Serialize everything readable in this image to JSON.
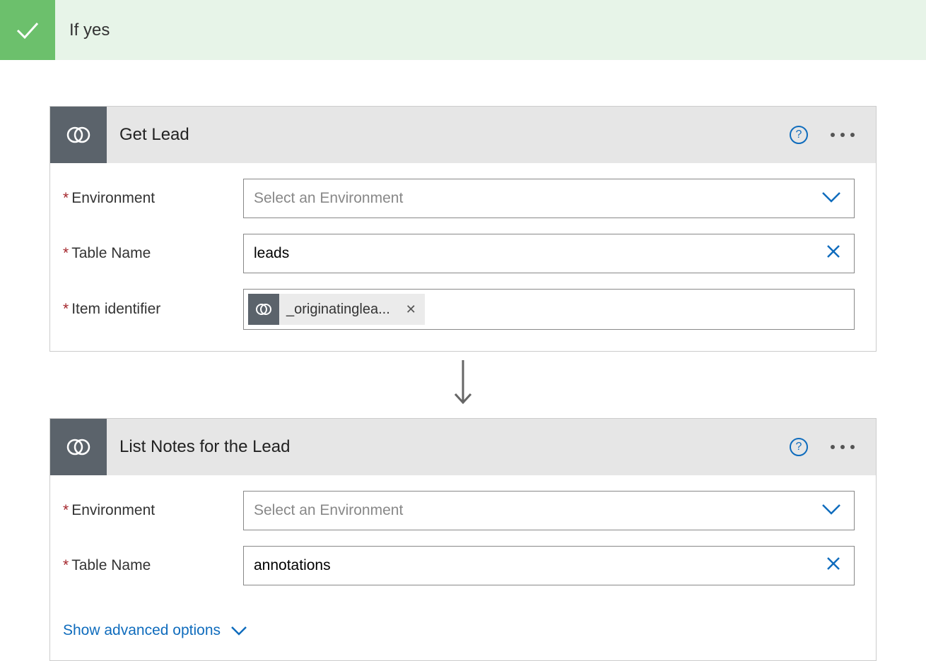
{
  "condition": {
    "title": "If yes"
  },
  "cards": [
    {
      "title": "Get Lead",
      "fields": {
        "environment": {
          "label": "Environment",
          "placeholder": "Select an Environment"
        },
        "tableName": {
          "label": "Table Name",
          "value": "leads"
        },
        "itemIdentifier": {
          "label": "Item identifier",
          "token": "_originatinglea..."
        }
      }
    },
    {
      "title": "List Notes for the Lead",
      "fields": {
        "environment": {
          "label": "Environment",
          "placeholder": "Select an Environment"
        },
        "tableName": {
          "label": "Table Name",
          "value": "annotations"
        }
      },
      "advancedOptions": "Show advanced options"
    }
  ]
}
